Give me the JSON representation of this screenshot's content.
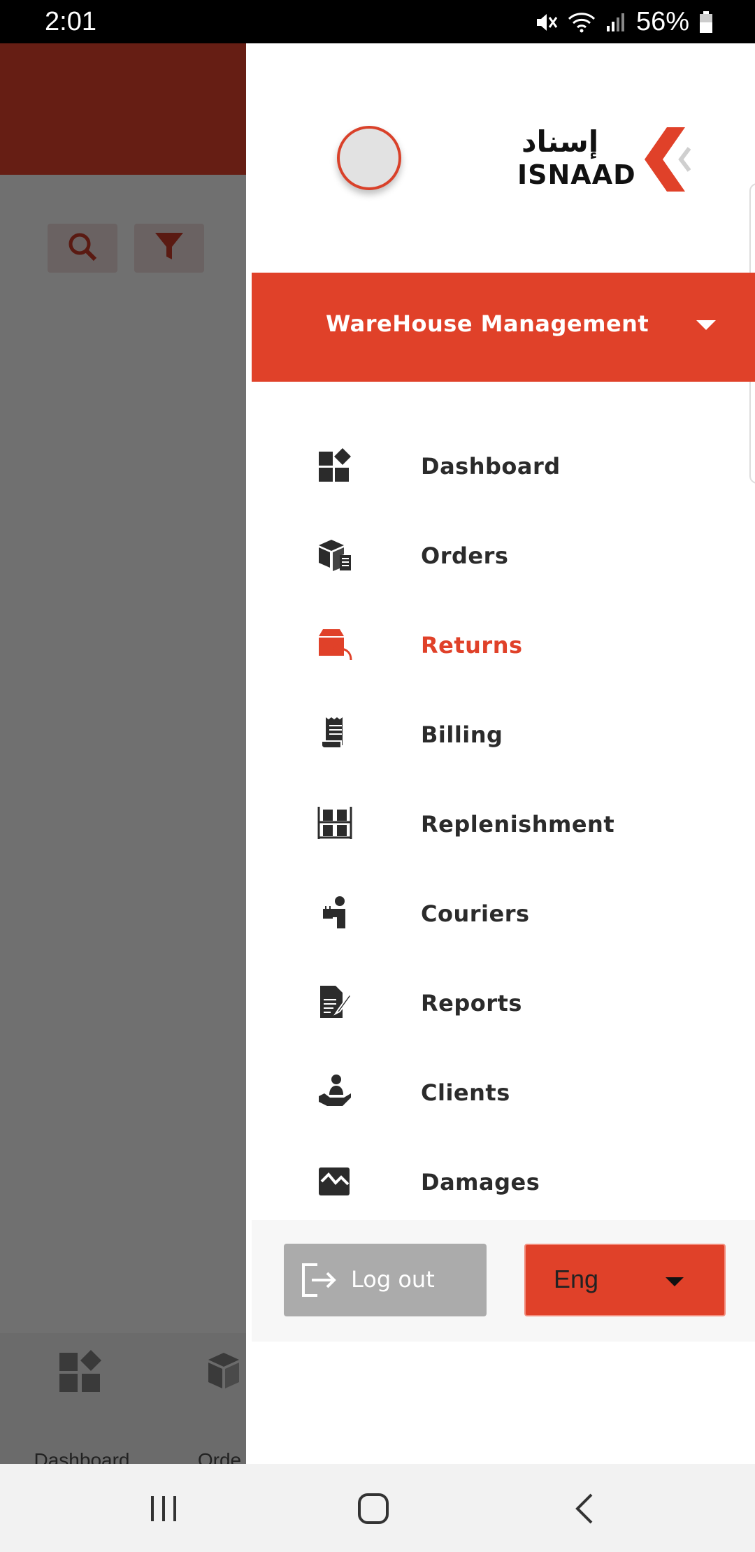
{
  "status_bar": {
    "time": "2:01",
    "battery": "56%"
  },
  "background_app": {
    "header_color": "#661e14",
    "bottom_nav": [
      {
        "label": "Dashboard",
        "icon": "dashboard-icon"
      },
      {
        "label": "Orde",
        "icon": "orders-icon"
      }
    ]
  },
  "drawer": {
    "logo": {
      "arabic": "إسناد",
      "english": "ISNAAD"
    },
    "section": {
      "title": "WareHouse Management"
    },
    "menu": [
      {
        "label": "Dashboard",
        "icon": "dashboard-icon",
        "active": false
      },
      {
        "label": "Orders",
        "icon": "orders-icon",
        "active": false
      },
      {
        "label": "Returns",
        "icon": "returns-icon",
        "active": true
      },
      {
        "label": "Billing",
        "icon": "billing-icon",
        "active": false
      },
      {
        "label": "Replenishment",
        "icon": "replenishment-icon",
        "active": false
      },
      {
        "label": "Couriers",
        "icon": "couriers-icon",
        "active": false
      },
      {
        "label": "Reports",
        "icon": "reports-icon",
        "active": false
      },
      {
        "label": "Clients",
        "icon": "clients-icon",
        "active": false
      },
      {
        "label": "Damages",
        "icon": "damages-icon",
        "active": false
      }
    ],
    "footer": {
      "logout_label": "Log out",
      "language_value": "Eng"
    }
  },
  "colors": {
    "accent": "#e04129",
    "text": "#2b2b2b"
  }
}
